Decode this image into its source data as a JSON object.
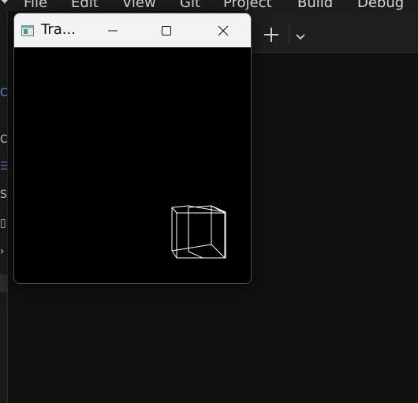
{
  "ide": {
    "menu": [
      "File",
      "Edit",
      "View",
      "Git",
      "Project",
      "Build",
      "Debug"
    ],
    "side_glyphs": [
      "C",
      "☰",
      "S",
      "▯",
      "›"
    ]
  },
  "app_window": {
    "title": "Tra...",
    "caption_buttons": [
      "minimize",
      "maximize",
      "close"
    ]
  },
  "icons": {
    "app": "app-window-icon",
    "add_tab": "plus-icon",
    "tab_list": "chevron-down-icon"
  },
  "colors": {
    "titlebar": "#f3f3f3",
    "canvas": "#000000",
    "wireframe": "#ffffff",
    "ide_background": "#111111"
  }
}
